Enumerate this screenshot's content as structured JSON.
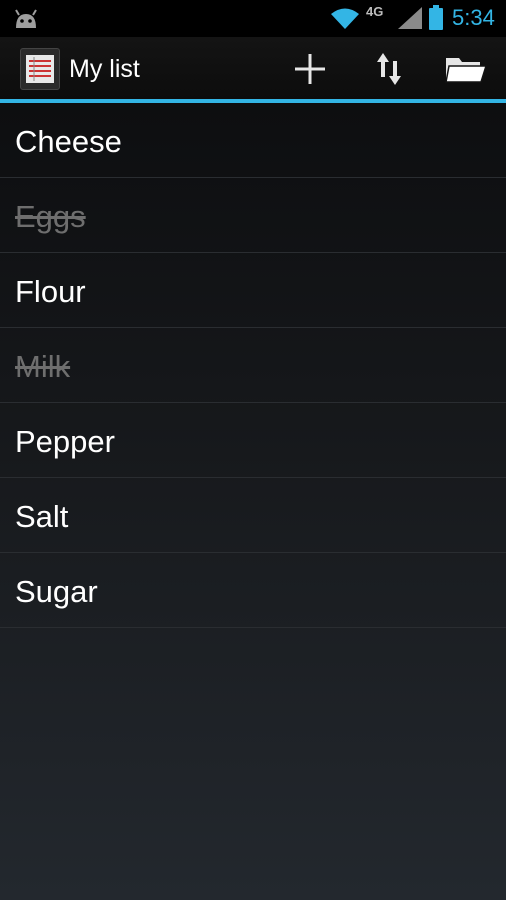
{
  "status_bar": {
    "network_label": "4G",
    "time": "5:34",
    "icons": [
      "android-icon",
      "wifi-icon",
      "signal-icon",
      "battery-icon"
    ]
  },
  "action_bar": {
    "title": "My list",
    "actions": [
      "add-icon",
      "sort-icon",
      "folder-icon"
    ]
  },
  "items": [
    {
      "label": "Cheese",
      "checked": false
    },
    {
      "label": "Eggs",
      "checked": true
    },
    {
      "label": "Flour",
      "checked": false
    },
    {
      "label": "Milk",
      "checked": true
    },
    {
      "label": "Pepper",
      "checked": false
    },
    {
      "label": "Salt",
      "checked": false
    },
    {
      "label": "Sugar",
      "checked": false
    }
  ],
  "colors": {
    "accent": "#33b5e5",
    "checked_text": "#6e6e6e",
    "text": "#ffffff"
  }
}
